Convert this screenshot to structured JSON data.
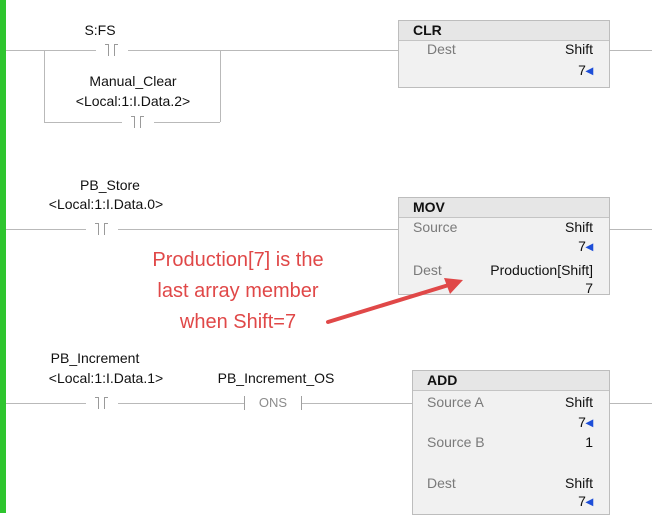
{
  "colors": {
    "rail": "#2ec52e",
    "annotation": "#e04848",
    "arrow_marker": "#1d4ed8"
  },
  "rung1": {
    "contact_tag": "S:FS",
    "branch_contact_tag": "Manual_Clear",
    "branch_contact_alias": "<Local:1:I.Data.2>",
    "instruction": {
      "name": "CLR",
      "dest_label": "Dest",
      "dest_tag": "Shift",
      "dest_value": "7"
    }
  },
  "rung2": {
    "contact_tag": "PB_Store",
    "contact_alias": "<Local:1:I.Data.0>",
    "instruction": {
      "name": "MOV",
      "source_label": "Source",
      "source_tag": "Shift",
      "source_value": "7",
      "dest_label": "Dest",
      "dest_tag": "Production[Shift]",
      "dest_value": "7"
    }
  },
  "rung3": {
    "contact_tag": "PB_Increment",
    "contact_alias": "<Local:1:I.Data.1>",
    "ons_tag": "PB_Increment_OS",
    "ons_label": "ONS",
    "instruction": {
      "name": "ADD",
      "source_a_label": "Source A",
      "source_a_tag": "Shift",
      "source_a_value": "7",
      "source_b_label": "Source B",
      "source_b_value": "1",
      "dest_label": "Dest",
      "dest_tag": "Shift",
      "dest_value": "7"
    }
  },
  "annotation": {
    "line1": "Production[7]  is the",
    "line2": "last array member",
    "line3": "when Shift=7"
  },
  "icons": {
    "value_marker": "left-arrow-marker"
  }
}
